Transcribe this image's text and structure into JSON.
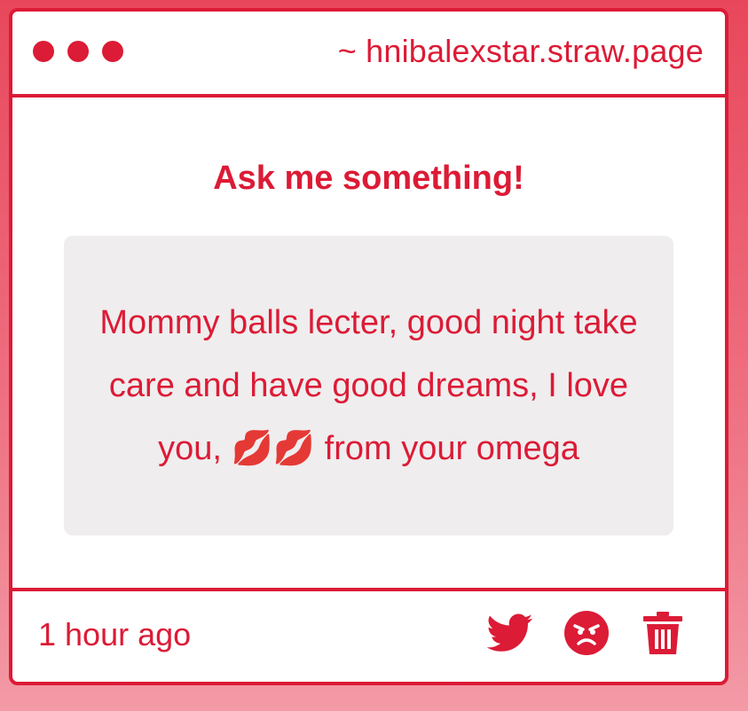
{
  "window": {
    "url": "~ hnibalexstar.straw.page"
  },
  "main": {
    "heading": "Ask me something!",
    "message": "Mommy balls lecter, good night take care and have good dreams, I love you, 💋💋 from your omega"
  },
  "footer": {
    "timestamp": "1 hour ago",
    "actions": [
      {
        "icon": "twitter-icon"
      },
      {
        "icon": "angry-face-icon"
      },
      {
        "icon": "trash-icon"
      }
    ]
  },
  "colors": {
    "accent": "#dc1b36",
    "bubble": "#efedee",
    "background_top": "#e8475b",
    "background_bottom": "#f39aa6"
  }
}
